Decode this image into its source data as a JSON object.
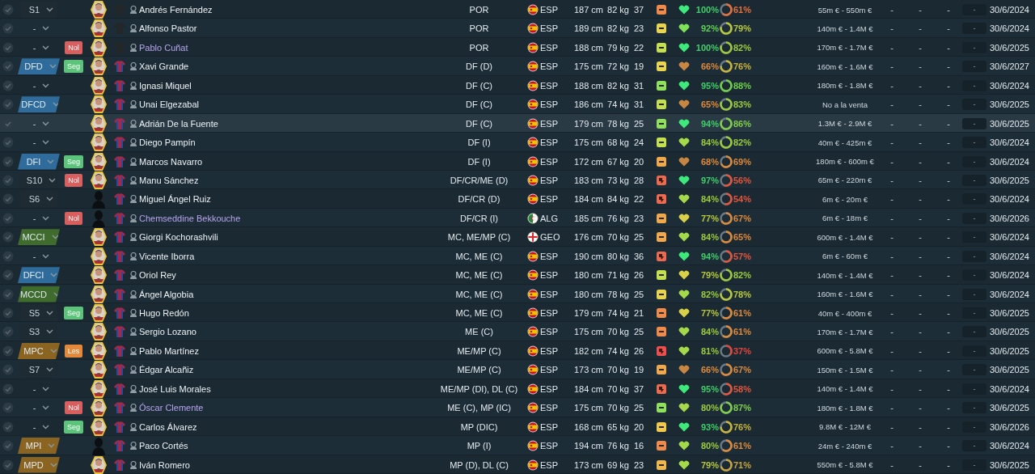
{
  "rows": [
    {
      "selected": false,
      "role": {
        "kind": "sub",
        "label": "S1"
      },
      "shirt": {
        "kind": "keeper"
      },
      "name": "Andrés Fernández",
      "marked": false,
      "position": "POR",
      "nation": {
        "kind": "esp",
        "code": "ESP"
      },
      "height": "187 cm",
      "weight": "82 kg",
      "age": "37",
      "morale": {
        "kind": "neutral",
        "color": "#f08a4b"
      },
      "condition": {
        "color": "#3ee87a"
      },
      "fitness": {
        "text": "100%",
        "color": "#3fcf6a"
      },
      "sharpness": {
        "text": "61%",
        "color": "#e4703c",
        "level": 0.61
      },
      "value": "55m € - 550m €",
      "stats": [
        "-",
        "-",
        "-"
      ],
      "box": "-",
      "contract": "30/6/2024"
    },
    {
      "selected": false,
      "role": {
        "kind": "none",
        "label": "-"
      },
      "shirt": {
        "kind": "keeper"
      },
      "name": "Alfonso Pastor",
      "marked": false,
      "position": "POR",
      "nation": {
        "kind": "esp",
        "code": "ESP"
      },
      "height": "189 cm",
      "weight": "82 kg",
      "age": "23",
      "morale": {
        "kind": "neutral",
        "color": "#e8d44d"
      },
      "condition": {
        "color": "#7fe05a"
      },
      "fitness": {
        "text": "92%",
        "color": "#5fcf52"
      },
      "sharpness": {
        "text": "79%",
        "color": "#b9c93c",
        "level": 0.79
      },
      "value": "140m € - 1.4M €",
      "stats": [
        "-",
        "-",
        "-"
      ],
      "box": "-",
      "contract": "30/6/2024"
    },
    {
      "selected": false,
      "role": {
        "kind": "none",
        "label": "-"
      },
      "tag": {
        "label": "Nol",
        "color": "#d95f5f"
      },
      "shirt": {
        "kind": "keeper"
      },
      "name": "Pablo Cuñat",
      "marked": true,
      "position": "POR",
      "nation": {
        "kind": "esp",
        "code": "ESP"
      },
      "height": "188 cm",
      "weight": "79 kg",
      "age": "22",
      "morale": {
        "kind": "neutral",
        "color": "#c4e04e"
      },
      "condition": {
        "color": "#3ee87a"
      },
      "fitness": {
        "text": "100%",
        "color": "#3fcf6a"
      },
      "sharpness": {
        "text": "82%",
        "color": "#9ccb3c",
        "level": 0.82
      },
      "value": "170m € - 1.7M €",
      "stats": [
        "-",
        "-",
        "-"
      ],
      "box": "-",
      "contract": "30/6/2025"
    },
    {
      "selected": false,
      "role": {
        "kind": "position",
        "label": "DFD",
        "color": "#2f6c9c"
      },
      "tag": {
        "label": "Seg",
        "color": "#5cc47a"
      },
      "shirt": {
        "kind": "outfield"
      },
      "name": "Xavi Grande",
      "marked": false,
      "position": "DF (D)",
      "nation": {
        "kind": "esp",
        "code": "ESP"
      },
      "height": "175 cm",
      "weight": "72 kg",
      "age": "19",
      "morale": {
        "kind": "neutral",
        "color": "#e8d44d"
      },
      "condition": {
        "color": "#c78642"
      },
      "fitness": {
        "text": "66%",
        "color": "#df8a3a"
      },
      "sharpness": {
        "text": "76%",
        "color": "#c9b43c",
        "level": 0.76
      },
      "value": "160m € - 1.6M €",
      "stats": [
        "-",
        "-",
        "-"
      ],
      "box": "-",
      "contract": "30/6/2027"
    },
    {
      "selected": false,
      "role": {
        "kind": "none",
        "label": "-"
      },
      "shirt": {
        "kind": "outfield"
      },
      "name": "Ignasi Miquel",
      "marked": false,
      "position": "DF (C)",
      "nation": {
        "kind": "esp",
        "code": "ESP"
      },
      "height": "188 cm",
      "weight": "82 kg",
      "age": "31",
      "morale": {
        "kind": "neutral",
        "color": "#8fe05a"
      },
      "condition": {
        "color": "#3ee87a"
      },
      "fitness": {
        "text": "95%",
        "color": "#3fcf6a"
      },
      "sharpness": {
        "text": "88%",
        "color": "#6fcf4a",
        "level": 0.88
      },
      "value": "180m € - 1.8M €",
      "stats": [
        "-",
        "-",
        "-"
      ],
      "box": "-",
      "contract": "30/6/2024"
    },
    {
      "selected": false,
      "role": {
        "kind": "position",
        "label": "DFCD",
        "color": "#2f6c9c"
      },
      "shirt": {
        "kind": "outfield"
      },
      "name": "Unai Elgezabal",
      "marked": false,
      "position": "DF (C)",
      "nation": {
        "kind": "esp",
        "code": "ESP"
      },
      "height": "186 cm",
      "weight": "74 kg",
      "age": "31",
      "morale": {
        "kind": "neutral",
        "color": "#c4e04e"
      },
      "condition": {
        "color": "#c78642"
      },
      "fitness": {
        "text": "65%",
        "color": "#df8a3a"
      },
      "sharpness": {
        "text": "83%",
        "color": "#9ccb3c",
        "level": 0.83
      },
      "value": "No a la venta",
      "stats": [
        "-",
        "-",
        "-"
      ],
      "box": "-",
      "contract": "30/6/2025"
    },
    {
      "selected": true,
      "role": {
        "kind": "none",
        "label": "-"
      },
      "shirt": {
        "kind": "outfield"
      },
      "name": "Adrián De la Fuente",
      "marked": false,
      "position": "DF (C)",
      "nation": {
        "kind": "esp",
        "code": "ESP"
      },
      "height": "179 cm",
      "weight": "78 kg",
      "age": "25",
      "morale": {
        "kind": "neutral",
        "color": "#8fe05a"
      },
      "condition": {
        "color": "#3ee87a"
      },
      "fitness": {
        "text": "94%",
        "color": "#3fcf6a"
      },
      "sharpness": {
        "text": "86%",
        "color": "#7fcf4a",
        "level": 0.86
      },
      "value": "1.3M € - 2.9M €",
      "stats": [
        "-",
        "-",
        "-"
      ],
      "box": "-",
      "contract": "30/6/2025"
    },
    {
      "selected": false,
      "role": {
        "kind": "none",
        "label": "-"
      },
      "shirt": {
        "kind": "outfield"
      },
      "name": "Diego Pampín",
      "marked": false,
      "position": "DF (I)",
      "nation": {
        "kind": "esp",
        "code": "ESP"
      },
      "height": "175 cm",
      "weight": "68 kg",
      "age": "24",
      "morale": {
        "kind": "neutral",
        "color": "#c4e04e"
      },
      "condition": {
        "color": "#a3d94a"
      },
      "fitness": {
        "text": "84%",
        "color": "#9ccb3c"
      },
      "sharpness": {
        "text": "82%",
        "color": "#9ccb3c",
        "level": 0.82
      },
      "value": "40m € - 425m €",
      "stats": [
        "-",
        "-",
        "-"
      ],
      "box": "-",
      "contract": "30/6/2024"
    },
    {
      "selected": false,
      "role": {
        "kind": "position",
        "label": "DFI",
        "color": "#2f6c9c"
      },
      "tag": {
        "label": "Seg",
        "color": "#5cc47a"
      },
      "shirt": {
        "kind": "outfield"
      },
      "name": "Marcos Navarro",
      "marked": false,
      "position": "DF (I)",
      "nation": {
        "kind": "esp",
        "code": "ESP"
      },
      "height": "172 cm",
      "weight": "67 kg",
      "age": "20",
      "morale": {
        "kind": "neutral",
        "color": "#f0a84b"
      },
      "condition": {
        "color": "#c78642"
      },
      "fitness": {
        "text": "68%",
        "color": "#df8a3a"
      },
      "sharpness": {
        "text": "69%",
        "color": "#df8a3a",
        "level": 0.69
      },
      "value": "180m € - 600m €",
      "stats": [
        "-",
        "-",
        "-"
      ],
      "box": "-",
      "contract": "30/6/2024"
    },
    {
      "selected": false,
      "role": {
        "kind": "sub",
        "label": "S10"
      },
      "tag": {
        "label": "Nol",
        "color": "#d95f5f"
      },
      "shirt": {
        "kind": "outfield"
      },
      "name": "Manu Sánchez",
      "marked": false,
      "position": "DF/CR/ME (D)",
      "nation": {
        "kind": "esp",
        "code": "ESP"
      },
      "height": "183 cm",
      "weight": "73 kg",
      "age": "28",
      "morale": {
        "kind": "down",
        "color": "#ee6a4e"
      },
      "condition": {
        "color": "#3ee87a"
      },
      "fitness": {
        "text": "97%",
        "color": "#3fcf6a"
      },
      "sharpness": {
        "text": "56%",
        "color": "#e4553c",
        "level": 0.56
      },
      "value": "65m € - 220m €",
      "stats": [
        "-",
        "-",
        "-"
      ],
      "box": "-",
      "contract": "30/6/2025"
    },
    {
      "selected": false,
      "role": {
        "kind": "sub",
        "label": "S6"
      },
      "avatar": {
        "kind": "silhouette"
      },
      "shirt": {
        "kind": "outfield"
      },
      "name": "Miguel Ángel Ruiz",
      "marked": false,
      "position": "DF/CR (D)",
      "nation": {
        "kind": "esp",
        "code": "ESP"
      },
      "height": "184 cm",
      "weight": "84 kg",
      "age": "22",
      "morale": {
        "kind": "down",
        "color": "#ee6a4e"
      },
      "condition": {
        "color": "#a3d94a"
      },
      "fitness": {
        "text": "84%",
        "color": "#9ccb3c"
      },
      "sharpness": {
        "text": "54%",
        "color": "#e4553c",
        "level": 0.54
      },
      "value": "6m € - 20m €",
      "stats": [
        "-",
        "-",
        "-"
      ],
      "box": "-",
      "contract": "30/6/2024"
    },
    {
      "selected": false,
      "role": {
        "kind": "none",
        "label": "-"
      },
      "tag": {
        "label": "Nol",
        "color": "#d95f5f"
      },
      "avatar": {
        "kind": "silhouette"
      },
      "shirt": {
        "kind": "outfield"
      },
      "name": "Chemseddine Bekkouche",
      "marked": true,
      "position": "DF/CR (I)",
      "nation": {
        "kind": "alg",
        "code": "ALG"
      },
      "height": "185 cm",
      "weight": "76 kg",
      "age": "23",
      "morale": {
        "kind": "neutral",
        "color": "#f0a84b"
      },
      "condition": {
        "color": "#d9d04a"
      },
      "fitness": {
        "text": "77%",
        "color": "#b9c93c"
      },
      "sharpness": {
        "text": "67%",
        "color": "#df8a3a",
        "level": 0.67
      },
      "value": "6m € - 18m €",
      "stats": [
        "-",
        "-",
        "-"
      ],
      "box": "-",
      "contract": "30/6/2026"
    },
    {
      "selected": false,
      "role": {
        "kind": "position",
        "label": "MCCI",
        "color": "#3f6b2c"
      },
      "shirt": {
        "kind": "outfield"
      },
      "name": "Giorgi Kochorashvili",
      "marked": false,
      "position": "MC, ME/MP (C)",
      "nation": {
        "kind": "geo",
        "code": "GEO"
      },
      "height": "176 cm",
      "weight": "70 kg",
      "age": "25",
      "morale": {
        "kind": "neutral",
        "color": "#f0a84b"
      },
      "condition": {
        "color": "#a3d94a"
      },
      "fitness": {
        "text": "84%",
        "color": "#9ccb3c"
      },
      "sharpness": {
        "text": "65%",
        "color": "#df8a3a",
        "level": 0.65
      },
      "value": "600m € - 1.4M €",
      "stats": [
        "-",
        "-",
        "-"
      ],
      "box": "-",
      "contract": "30/6/2024"
    },
    {
      "selected": false,
      "role": {
        "kind": "none",
        "label": "-"
      },
      "shirt": {
        "kind": "outfield"
      },
      "name": "Vicente Iborra",
      "marked": false,
      "position": "MC, ME (C)",
      "nation": {
        "kind": "esp",
        "code": "ESP"
      },
      "height": "190 cm",
      "weight": "80 kg",
      "age": "36",
      "morale": {
        "kind": "down",
        "color": "#ee6a4e"
      },
      "condition": {
        "color": "#3ee87a"
      },
      "fitness": {
        "text": "94%",
        "color": "#3fcf6a"
      },
      "sharpness": {
        "text": "57%",
        "color": "#e4553c",
        "level": 0.57
      },
      "value": "6m € - 60m €",
      "stats": [
        "-",
        "-",
        "-"
      ],
      "box": "-",
      "contract": "30/6/2024"
    },
    {
      "selected": false,
      "role": {
        "kind": "position",
        "label": "DFCI",
        "color": "#2f6c9c"
      },
      "shirt": {
        "kind": "outfield"
      },
      "name": "Oriol Rey",
      "marked": false,
      "position": "MC, ME (C)",
      "nation": {
        "kind": "esp",
        "code": "ESP"
      },
      "height": "180 cm",
      "weight": "71 kg",
      "age": "26",
      "morale": {
        "kind": "neutral",
        "color": "#c4e04e"
      },
      "condition": {
        "color": "#d9d04a"
      },
      "fitness": {
        "text": "79%",
        "color": "#b9c93c"
      },
      "sharpness": {
        "text": "82%",
        "color": "#9ccb3c",
        "level": 0.82
      },
      "value": "140m € - 1.4M €",
      "stats": [
        "-",
        "-",
        "-"
      ],
      "box": "-",
      "contract": "30/6/2024"
    },
    {
      "selected": false,
      "role": {
        "kind": "position",
        "label": "MCCD",
        "color": "#3f6b2c"
      },
      "shirt": {
        "kind": "outfield"
      },
      "name": "Ángel Algobia",
      "marked": false,
      "position": "MC, ME (C)",
      "nation": {
        "kind": "esp",
        "code": "ESP"
      },
      "height": "180 cm",
      "weight": "78 kg",
      "age": "25",
      "morale": {
        "kind": "neutral",
        "color": "#e8d44d"
      },
      "condition": {
        "color": "#a3d94a"
      },
      "fitness": {
        "text": "82%",
        "color": "#9ccb3c"
      },
      "sharpness": {
        "text": "78%",
        "color": "#b9c93c",
        "level": 0.78
      },
      "value": "160m € - 1.6M €",
      "stats": [
        "-",
        "-",
        "-"
      ],
      "box": "-",
      "contract": "30/6/2024"
    },
    {
      "selected": false,
      "role": {
        "kind": "sub",
        "label": "S5"
      },
      "tag": {
        "label": "Seg",
        "color": "#5cc47a"
      },
      "shirt": {
        "kind": "outfield"
      },
      "name": "Hugo Redón",
      "marked": false,
      "position": "MC, ME (C)",
      "nation": {
        "kind": "esp",
        "code": "ESP"
      },
      "height": "179 cm",
      "weight": "74 kg",
      "age": "21",
      "morale": {
        "kind": "neutral",
        "color": "#f08a4b"
      },
      "condition": {
        "color": "#d9d04a"
      },
      "fitness": {
        "text": "77%",
        "color": "#b9c93c"
      },
      "sharpness": {
        "text": "61%",
        "color": "#df8a3a",
        "level": 0.61
      },
      "value": "40m € - 400m €",
      "stats": [
        "-",
        "-",
        "-"
      ],
      "box": "-",
      "contract": "30/6/2025"
    },
    {
      "selected": false,
      "role": {
        "kind": "sub",
        "label": "S3"
      },
      "shirt": {
        "kind": "outfield"
      },
      "name": "Sergio Lozano",
      "marked": false,
      "position": "ME (C)",
      "nation": {
        "kind": "esp",
        "code": "ESP"
      },
      "height": "175 cm",
      "weight": "70 kg",
      "age": "25",
      "morale": {
        "kind": "neutral",
        "color": "#f08a4b"
      },
      "condition": {
        "color": "#a3d94a"
      },
      "fitness": {
        "text": "84%",
        "color": "#9ccb3c"
      },
      "sharpness": {
        "text": "61%",
        "color": "#df8a3a",
        "level": 0.61
      },
      "value": "170m € - 1.7M €",
      "stats": [
        "-",
        "-",
        "-"
      ],
      "box": "-",
      "contract": "30/6/2025"
    },
    {
      "selected": false,
      "role": {
        "kind": "position",
        "label": "MPC",
        "color": "#8a6420"
      },
      "tag": {
        "label": "Les",
        "color": "#e2893c"
      },
      "shirt": {
        "kind": "outfield"
      },
      "name": "Pablo Martínez",
      "marked": false,
      "position": "ME/MP (C)",
      "nation": {
        "kind": "esp",
        "code": "ESP"
      },
      "height": "182 cm",
      "weight": "74 kg",
      "age": "26",
      "morale": {
        "kind": "down",
        "color": "#ee4e4e"
      },
      "condition": {
        "color": "#a3d94a"
      },
      "fitness": {
        "text": "81%",
        "color": "#9ccb3c"
      },
      "sharpness": {
        "text": "37%",
        "color": "#e4453c",
        "level": 0.37
      },
      "value": "600m € - 5.8M €",
      "stats": [
        "-",
        "-",
        "-"
      ],
      "box": "-",
      "contract": "30/6/2025"
    },
    {
      "selected": false,
      "role": {
        "kind": "sub",
        "label": "S7"
      },
      "shirt": {
        "kind": "outfield"
      },
      "name": "Édgar Alcañiz",
      "marked": false,
      "position": "ME/MP (C)",
      "nation": {
        "kind": "esp",
        "code": "ESP"
      },
      "height": "173 cm",
      "weight": "70 kg",
      "age": "19",
      "morale": {
        "kind": "neutral",
        "color": "#f0a84b"
      },
      "condition": {
        "color": "#c78642"
      },
      "fitness": {
        "text": "66%",
        "color": "#df8a3a"
      },
      "sharpness": {
        "text": "67%",
        "color": "#df8a3a",
        "level": 0.67
      },
      "value": "150m € - 1.5M €",
      "stats": [
        "-",
        "-",
        "-"
      ],
      "box": "-",
      "contract": "30/6/2025"
    },
    {
      "selected": false,
      "role": {
        "kind": "none",
        "label": "-"
      },
      "shirt": {
        "kind": "outfield"
      },
      "name": "José Luis Morales",
      "marked": false,
      "position": "ME/MP (DI), DL (C)",
      "nation": {
        "kind": "esp",
        "code": "ESP"
      },
      "height": "184 cm",
      "weight": "70 kg",
      "age": "37",
      "morale": {
        "kind": "down",
        "color": "#ee6a4e"
      },
      "condition": {
        "color": "#3ee87a"
      },
      "fitness": {
        "text": "95%",
        "color": "#3fcf6a"
      },
      "sharpness": {
        "text": "58%",
        "color": "#e4553c",
        "level": 0.58
      },
      "value": "140m € - 1.4M €",
      "stats": [
        "-",
        "-",
        "-"
      ],
      "box": "-",
      "contract": "30/6/2024"
    },
    {
      "selected": false,
      "role": {
        "kind": "none",
        "label": "-"
      },
      "tag": {
        "label": "Nol",
        "color": "#d95f5f"
      },
      "shirt": {
        "kind": "outfield"
      },
      "name": "Óscar Clemente",
      "marked": true,
      "position": "ME (C), MP (IC)",
      "nation": {
        "kind": "esp",
        "code": "ESP"
      },
      "height": "175 cm",
      "weight": "70 kg",
      "age": "25",
      "morale": {
        "kind": "neutral",
        "color": "#8fe05a"
      },
      "condition": {
        "color": "#a3d94a"
      },
      "fitness": {
        "text": "80%",
        "color": "#9ccb3c"
      },
      "sharpness": {
        "text": "87%",
        "color": "#7fcf4a",
        "level": 0.87
      },
      "value": "180m € - 1.8M €",
      "stats": [
        "-",
        "-",
        "-"
      ],
      "box": "-",
      "contract": "30/6/2025"
    },
    {
      "selected": false,
      "role": {
        "kind": "none",
        "label": "-"
      },
      "tag": {
        "label": "Seg",
        "color": "#5cc47a"
      },
      "shirt": {
        "kind": "outfield"
      },
      "name": "Carlos Álvarez",
      "marked": false,
      "position": "MP (DIC)",
      "nation": {
        "kind": "esp",
        "code": "ESP"
      },
      "height": "168 cm",
      "weight": "65 kg",
      "age": "20",
      "morale": {
        "kind": "neutral",
        "color": "#f0c84b"
      },
      "condition": {
        "color": "#3ee87a"
      },
      "fitness": {
        "text": "93%",
        "color": "#3fcf6a"
      },
      "sharpness": {
        "text": "76%",
        "color": "#c9b43c",
        "level": 0.76
      },
      "value": "9.8M € - 12M €",
      "stats": [
        "-",
        "-",
        "-"
      ],
      "box": "-",
      "contract": "30/6/2026"
    },
    {
      "selected": false,
      "role": {
        "kind": "position",
        "label": "MPI",
        "color": "#8a6420"
      },
      "avatar": {
        "kind": "silhouette"
      },
      "shirt": {
        "kind": "outfield"
      },
      "name": "Paco Cortés",
      "marked": false,
      "position": "MP (I)",
      "nation": {
        "kind": "esp",
        "code": "ESP"
      },
      "height": "194 cm",
      "weight": "76 kg",
      "age": "16",
      "morale": {
        "kind": "neutral",
        "color": "#f08a4b"
      },
      "condition": {
        "color": "#a3d94a"
      },
      "fitness": {
        "text": "80%",
        "color": "#9ccb3c"
      },
      "sharpness": {
        "text": "61%",
        "color": "#df8a3a",
        "level": 0.61
      },
      "value": "24m € - 240m €",
      "stats": [
        "-",
        "-",
        "-"
      ],
      "box": "-",
      "contract": "30/6/2024"
    },
    {
      "selected": false,
      "role": {
        "kind": "position",
        "label": "MPD",
        "color": "#8a6420"
      },
      "shirt": {
        "kind": "outfield"
      },
      "name": "Iván Romero",
      "marked": false,
      "position": "MP (D), DL (C)",
      "nation": {
        "kind": "esp",
        "code": "ESP"
      },
      "height": "173 cm",
      "weight": "69 kg",
      "age": "23",
      "morale": {
        "kind": "neutral",
        "color": "#f0b84b"
      },
      "condition": {
        "color": "#a3d94a"
      },
      "fitness": {
        "text": "79%",
        "color": "#b9c93c"
      },
      "sharpness": {
        "text": "71%",
        "color": "#c9a43c",
        "level": 0.71
      },
      "value": "550m € - 5.8M €",
      "stats": [
        "-",
        "-",
        "-"
      ],
      "box": "-",
      "contract": "30/6/2025"
    }
  ]
}
